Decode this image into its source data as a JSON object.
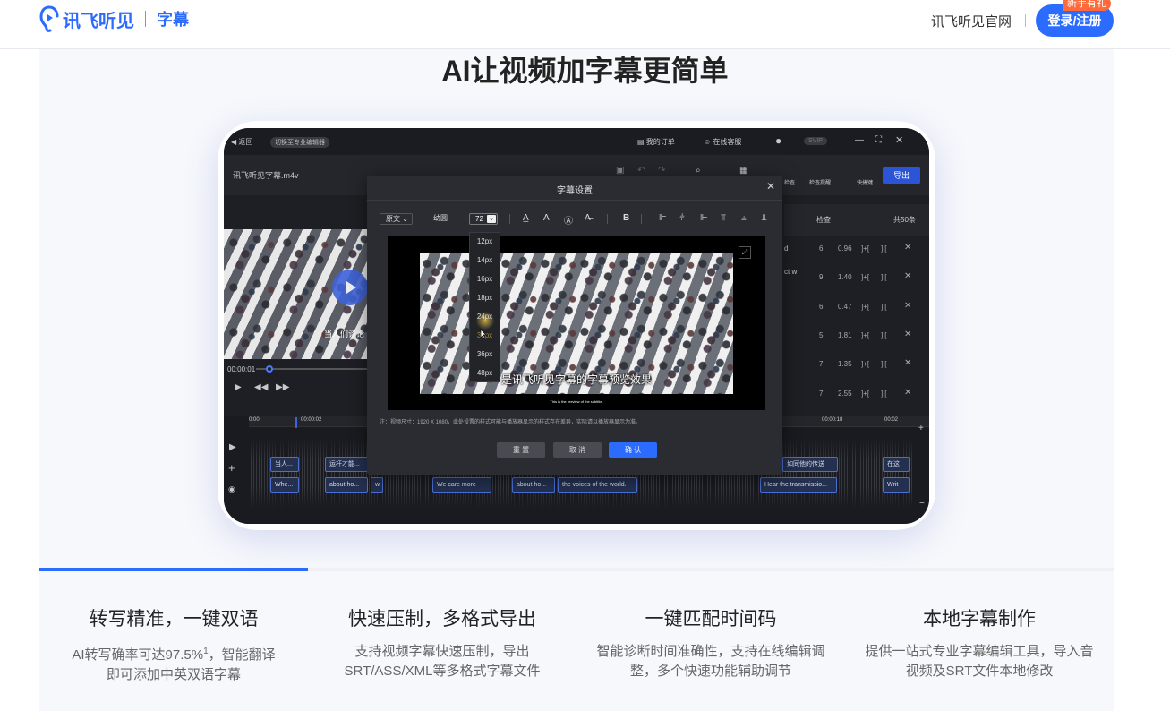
{
  "header": {
    "logo_text": "讯飞听见",
    "logo_sub": "字幕",
    "official_link": "讯飞听见官网",
    "login_button": "登录/注册",
    "gift_badge": "新手有礼"
  },
  "hero": {
    "title": "AI让视频加字幕更简单"
  },
  "app": {
    "back": "返回",
    "switch_editor": "切换至专业编辑器",
    "my_orders": "我的订单",
    "online_service": "在线客服",
    "vip": "SVIP",
    "filename": "讯飞听见字幕.m4v",
    "tool_check": "检查",
    "tool_recheck": "检查提醒",
    "tool_shortcut": "快捷键",
    "export": "导出",
    "list_header_check": "检查",
    "list_header_total": "共50条",
    "current_time": "00:00:01",
    "video_caption": "当人们谈论",
    "list_rows": [
      {
        "id": "6",
        "dur": "0.96"
      },
      {
        "id": "9",
        "dur": "1.40"
      },
      {
        "id": "6",
        "dur": "0.47"
      },
      {
        "id": "5",
        "dur": "1.81"
      },
      {
        "id": "7",
        "dur": "1.35"
      },
      {
        "id": "7",
        "dur": "2.55"
      }
    ],
    "list_snippets": [
      "d",
      "ct w"
    ],
    "ruler_labels": [
      "0:00",
      "00:00:02",
      "00:00:18",
      "00:02"
    ],
    "clips_cn": [
      "当人...",
      "运杆才能...",
      "如同他的传送",
      "在这"
    ],
    "clips_en": [
      "Whe...",
      "about ho...",
      "w",
      "We care more",
      "about ho...",
      "the voices of the world.",
      "Hear the transmissio...",
      "Writ"
    ]
  },
  "modal": {
    "title": "字幕设置",
    "lang_select": "原文",
    "font_label": "幼圆",
    "size_value": "72",
    "size_options": [
      "12px",
      "14px",
      "16px",
      "18px",
      "24px",
      "30px",
      "36px",
      "48px"
    ],
    "hover_option_index": 5,
    "subtitle_cn": "是讯飞听见字幕的字幕预览效果",
    "subtitle_en": "This is the preview of the subtitle.",
    "note": "注：视频尺寸：1920 X 1080，此处设置的样式可能与播放器显示的样式存在差异，实际请以播放器显示为准。",
    "btn_reset": "重 置",
    "btn_cancel": "取 消",
    "btn_confirm": "确 认"
  },
  "features": [
    {
      "title": "转写精准，一键双语",
      "desc_line1": "AI转写确率可达97.5%",
      "sup": "1",
      "desc_line1_end": "，智能翻译",
      "desc_line2": "即可添加中英双语字幕"
    },
    {
      "title": "快速压制，多格式导出",
      "desc_line1": "支持视频字幕快速压制，导出",
      "desc_line2": "SRT/ASS/XML等多格式字幕文件"
    },
    {
      "title": "一键匹配时间码",
      "desc_line1": "智能诊断时间准确性，支持在线编辑调",
      "desc_line2": "整，多个快速功能辅助调节"
    },
    {
      "title": "本地字幕制作",
      "desc_line1": "提供一站式专业字幕编辑工具，导入音",
      "desc_line2": "视频及SRT文件本地修改"
    }
  ],
  "colors": {
    "brand": "#2b6cff",
    "badge": "#ff6a3d",
    "page_bg": "#f6f8fc"
  },
  "active_feature_index": 0
}
